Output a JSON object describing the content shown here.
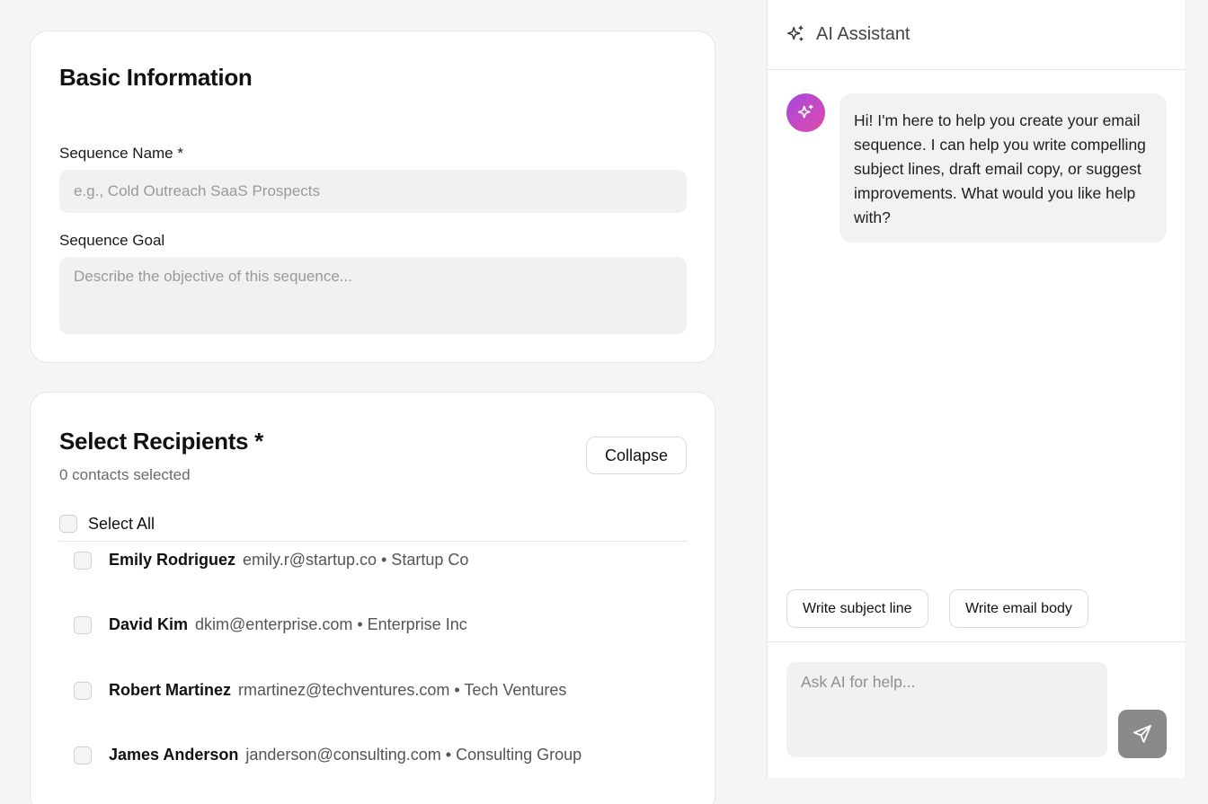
{
  "basic_info": {
    "title": "Basic Information",
    "sequence_name_label": "Sequence Name *",
    "sequence_name_value": "",
    "sequence_name_placeholder": "e.g., Cold Outreach SaaS Prospects",
    "sequence_goal_label": "Sequence Goal",
    "sequence_goal_value": "",
    "sequence_goal_placeholder": "Describe the objective of this sequence..."
  },
  "recipients": {
    "title": "Select Recipients *",
    "count_text": "0 contacts selected",
    "collapse_label": "Collapse",
    "select_all_label": "Select All",
    "contacts": [
      {
        "name": "Emily Rodriguez",
        "meta": "emily.r@startup.co • Startup Co",
        "checked": false
      },
      {
        "name": "David Kim",
        "meta": "dkim@enterprise.com • Enterprise Inc",
        "checked": false
      },
      {
        "name": "Robert Martinez",
        "meta": "rmartinez@techventures.com • Tech Ventures",
        "checked": false
      },
      {
        "name": "James Anderson",
        "meta": "janderson@consulting.com • Consulting Group",
        "checked": false
      }
    ]
  },
  "assistant": {
    "title": "AI Assistant",
    "header_icon": "sparkles-icon",
    "avatar_icon": "sparkles-icon",
    "message": "Hi! I'm here to help you create your email sequence. I can help you write compelling subject lines, draft email copy, or suggest improvements. What would you like help with?",
    "chips": [
      "Write subject line",
      "Write email body"
    ],
    "input_value": "",
    "input_placeholder": "Ask AI for help...",
    "send_icon": "send-icon"
  },
  "colors": {
    "accent_gradient_start": "#a548e0",
    "accent_gradient_end": "#e04aa8",
    "send_button": "#8a8a8a",
    "input_background": "#f1f1f1"
  }
}
